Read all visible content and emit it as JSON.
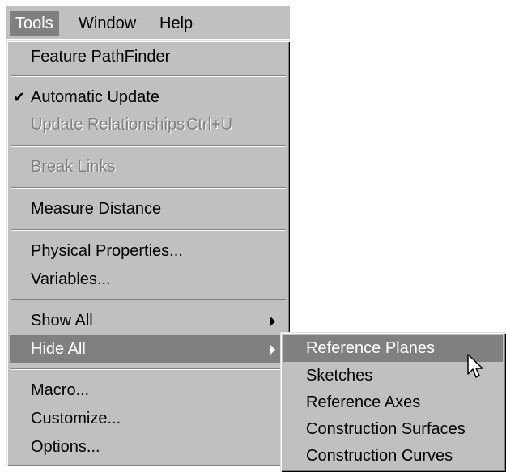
{
  "menubar": {
    "items": [
      {
        "label": "Tools",
        "active": true
      },
      {
        "label": "Window",
        "active": false
      },
      {
        "label": "Help",
        "active": false
      }
    ]
  },
  "tools_menu": {
    "items": [
      {
        "label": "Feature PathFinder",
        "enabled": true
      },
      {
        "label": "Automatic Update",
        "enabled": true,
        "checked": true
      },
      {
        "label": "Update Relationships",
        "enabled": false,
        "shortcut": "Ctrl+U"
      },
      {
        "label": "Break Links",
        "enabled": false
      },
      {
        "label": "Measure Distance",
        "enabled": true
      },
      {
        "label": "Physical Properties...",
        "enabled": true
      },
      {
        "label": "Variables...",
        "enabled": true
      },
      {
        "label": "Show All",
        "enabled": true,
        "has_submenu": true
      },
      {
        "label": "Hide All",
        "enabled": true,
        "has_submenu": true,
        "highlighted": true
      },
      {
        "label": "Macro...",
        "enabled": true
      },
      {
        "label": "Customize...",
        "enabled": true
      },
      {
        "label": "Options...",
        "enabled": true
      }
    ]
  },
  "hide_all_submenu": {
    "items": [
      {
        "label": "Reference Planes",
        "highlighted": true
      },
      {
        "label": "Sketches"
      },
      {
        "label": "Reference Axes"
      },
      {
        "label": "Construction Surfaces"
      },
      {
        "label": "Construction Curves"
      }
    ]
  },
  "icons": {
    "checkmark": "checkmark-icon",
    "submenu_arrow": "submenu-arrow-icon",
    "cursor": "mouse-pointer-icon"
  },
  "colors": {
    "menu_face": "#c0c0c0",
    "highlight": "#808080",
    "highlight_text": "#ffffff",
    "disabled_text": "#808080"
  }
}
